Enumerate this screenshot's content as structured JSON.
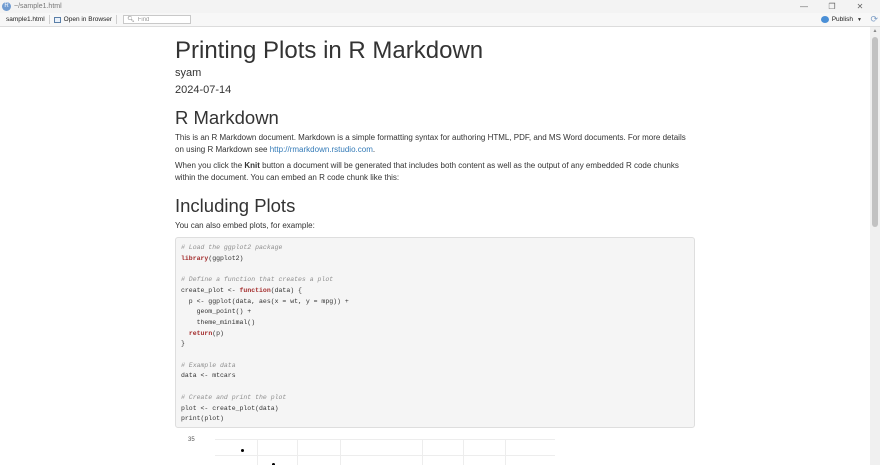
{
  "window": {
    "title": "~/sample1.html",
    "app_icon": "R",
    "controls": [
      "—",
      "❐",
      "✕"
    ]
  },
  "toolbar": {
    "file_label": "sample1.html",
    "open_browser_label": "Open in Browser",
    "find_placeholder": "Find",
    "find_value": "",
    "publish_label": "Publish",
    "refresh_glyph": "⟳"
  },
  "document": {
    "title": "Printing Plots in R Markdown",
    "author": "syam",
    "date": "2024-07-14",
    "section1": {
      "heading": "R Markdown",
      "p1_text": "This is an R Markdown document. Markdown is a simple formatting syntax for authoring HTML, PDF, and MS Word documents. For more details on using R Markdown see ",
      "p1_link": "http://rmarkdown.rstudio.com",
      "p1_end": ".",
      "p2_before": "When you click the ",
      "p2_bold": "Knit",
      "p2_after": " button a document will be generated that includes both content as well as the output of any embedded R code chunks within the document. You can embed an R code chunk like this:"
    },
    "section2": {
      "heading": "Including Plots",
      "p_text": "You can also embed plots, for example:"
    },
    "code_lines": [
      [
        {
          "t": "# Load the ggplot2 package",
          "c": "cm"
        }
      ],
      [
        {
          "t": "library",
          "c": "kw"
        },
        {
          "t": "(ggplot2)",
          "c": ""
        }
      ],
      [
        {
          "t": "",
          "c": ""
        }
      ],
      [
        {
          "t": "# Define a function that creates a plot",
          "c": "cm"
        }
      ],
      [
        {
          "t": "create_plot <- ",
          "c": ""
        },
        {
          "t": "function",
          "c": "kw"
        },
        {
          "t": "(data) {",
          "c": ""
        }
      ],
      [
        {
          "t": "  p <- ggplot(data, aes(x = wt, y = mpg)) +",
          "c": ""
        }
      ],
      [
        {
          "t": "    geom_point() +",
          "c": ""
        }
      ],
      [
        {
          "t": "    theme_minimal()",
          "c": ""
        }
      ],
      [
        {
          "t": "  ",
          "c": ""
        },
        {
          "t": "return",
          "c": "kw"
        },
        {
          "t": "(p)",
          "c": ""
        }
      ],
      [
        {
          "t": "}",
          "c": ""
        }
      ],
      [
        {
          "t": "",
          "c": ""
        }
      ],
      [
        {
          "t": "# Example data",
          "c": "cm"
        }
      ],
      [
        {
          "t": "data <- mtcars",
          "c": ""
        }
      ],
      [
        {
          "t": "",
          "c": ""
        }
      ],
      [
        {
          "t": "# Create and print the plot",
          "c": "cm"
        }
      ],
      [
        {
          "t": "plot <- create_plot(data)",
          "c": ""
        }
      ],
      [
        {
          "t": "print(plot)",
          "c": ""
        }
      ]
    ],
    "plot_y_tick": "35"
  },
  "colors": {
    "link": "#337ab7",
    "keyword": "#a32c2c",
    "comment": "#8f8f8f",
    "code_bg": "#f5f5f5"
  }
}
